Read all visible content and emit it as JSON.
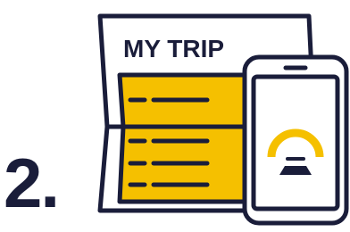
{
  "step": {
    "number": "2."
  },
  "document": {
    "title": "MY TRIP"
  },
  "colors": {
    "ink": "#1a1d3a",
    "accent": "#f5c000",
    "paper": "#ffffff"
  },
  "icons": {
    "document": "folded-document-icon",
    "phone": "smartphone-icon",
    "app_logo": "app-logo-icon"
  }
}
